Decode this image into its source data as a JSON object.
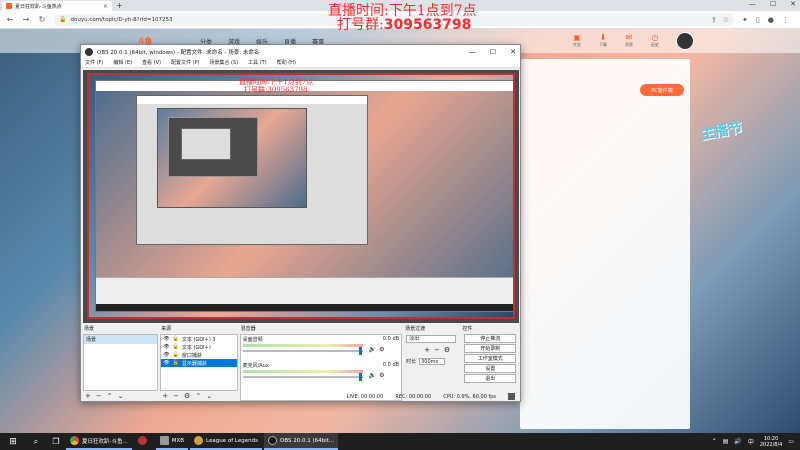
{
  "browser": {
    "tab_title": "夏日狂欢趴-斗鱼热点",
    "url": "douyu.com/topic/D-yh-8?rid=107253"
  },
  "douyu": {
    "logo": "斗鱼",
    "nav": [
      "分类",
      "游戏",
      "娱乐",
      "直播",
      "赛事"
    ],
    "header_icons": [
      "任务",
      "下载",
      "消息",
      "历史",
      "关注"
    ],
    "pc_client_button": "PC客户端",
    "festival_logo": "主播节"
  },
  "overlay": {
    "line1": "直播时间:下午1点到7点",
    "line2_prefix": "打号群:",
    "line2_number": "309563798"
  },
  "obs": {
    "title": "OBS 20.0.1 (64bit, windows) - 配置文件: 未命名 - 场景: 未命名",
    "menu": [
      "文件 (F)",
      "编辑 (E)",
      "查看 (V)",
      "配置文件 (P)",
      "场景集合 (S)",
      "工具 (T)",
      "帮助 (H)"
    ],
    "docks": {
      "scenes": {
        "title": "场景",
        "items": [
          "场景"
        ]
      },
      "sources": {
        "title": "来源",
        "items": [
          "文本 (GDI+) 3",
          "文本 (GDI+)",
          "窗口捕获",
          "显示器捕获"
        ],
        "selected_index": 3
      },
      "mixer": {
        "title": "混音器",
        "channels": [
          {
            "name": "桌面音频",
            "db": "0.0 dB"
          },
          {
            "name": "麦克风/Aux",
            "db": "0.0 dB"
          }
        ]
      },
      "transitions": {
        "title": "场景过渡",
        "value": "淡出",
        "duration_label": "时长",
        "duration": "300ms"
      },
      "controls": {
        "title": "控件",
        "buttons": [
          "停止推流",
          "开始录制",
          "工作室模式",
          "设置",
          "退出"
        ]
      }
    },
    "status": {
      "live": "LIVE: 00:00:00",
      "rec": "REC: 00:00:00",
      "cpu": "CPU: 0.9%, 60.00 fps"
    }
  },
  "taskbar": {
    "apps": [
      "夏日狂欢趴-斗鱼...",
      "",
      "MXB",
      "League of Legends",
      "OBS 20.0.1 (64bit..."
    ],
    "time": "10:20",
    "date": "2022/8/4"
  }
}
